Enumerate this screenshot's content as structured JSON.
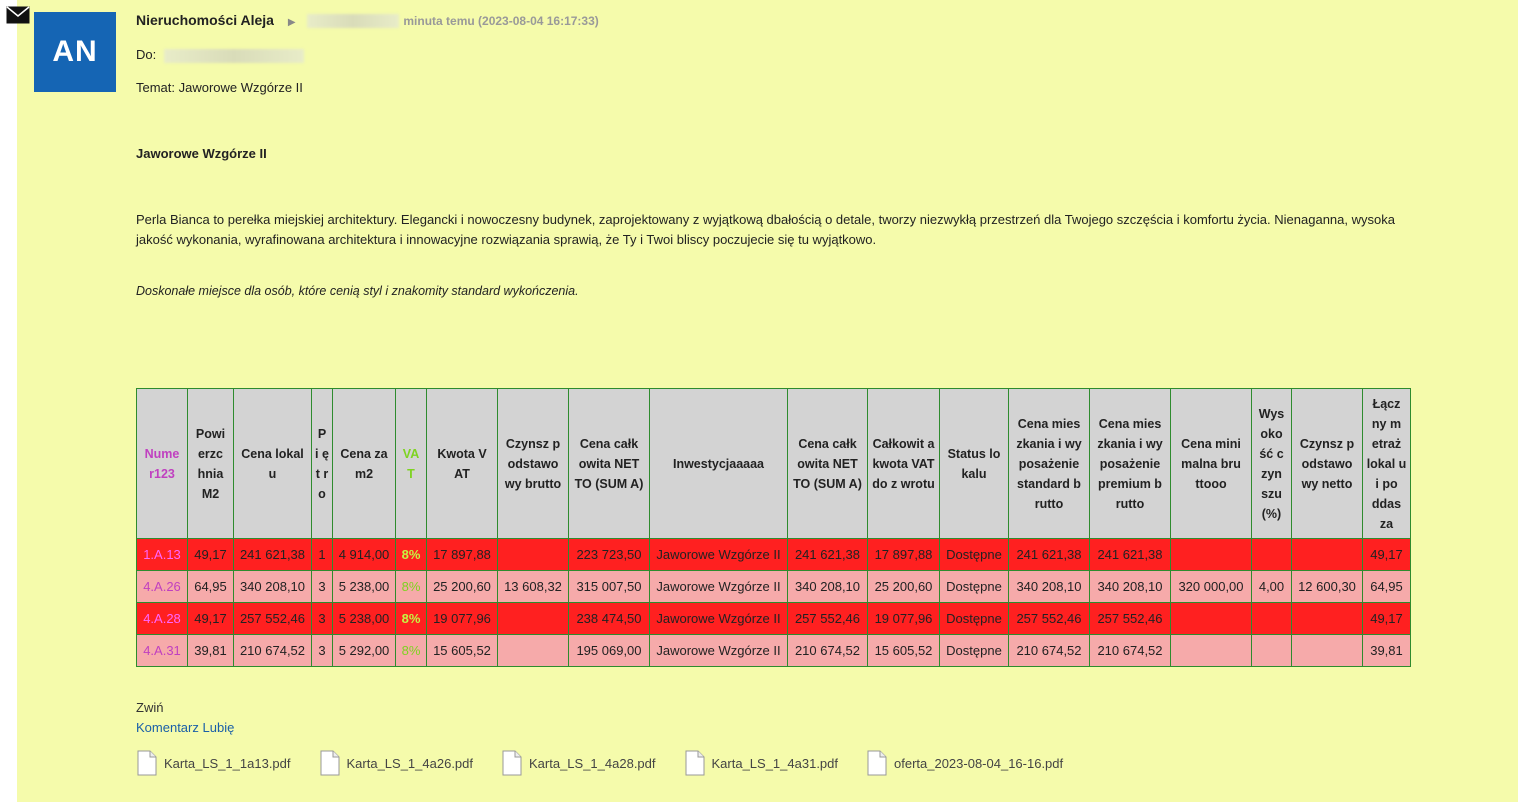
{
  "header": {
    "avatar_initials": "AN",
    "sender_name": "Nieruchomości Aleja",
    "time": "minuta temu (2023-08-04 16:17:33)",
    "to_label": "Do:",
    "subject": "Temat: Jaworowe Wzgórze II"
  },
  "message": {
    "title": "Jaworowe Wzgórze II",
    "paragraph": "Perla Bianca to perełka miejskiej architektury. Elegancki i nowoczesny budynek, zaprojektowany z wyjątkową dbałością o detale, tworzy niezwykłą przestrzeń dla Twojego szczęścia i komfortu życia. Nienaganna, wysoka jakość wykonania, wyrafinowana architektura i innowacyjne rozwiązania sprawią, że Ty i Twoi bliscy poczujecie się tu wyjątkowo.",
    "tagline": "Doskonałe miejsce dla osób, które cenią styl i znakomity standard wykończenia."
  },
  "table": {
    "headers": [
      "Nume r123",
      "Powi erzc hnia M2",
      "Cena lokal u",
      "P i ę t r o",
      "Cena za m2",
      "VA T",
      "Kwota V AT",
      "Czynsz p odstawo wy brutto",
      "Cena całk owita NET TO (SUM A)",
      "Inwestycjaaaaa",
      "Cena całk owita NET TO (SUM A)",
      "Całkowit a kwota VAT do z wrotu",
      "Status lo kalu",
      "Cena mies zkania i wy posażenie standard b rutto",
      "Cena mies zkania i wy posażenie premium b rutto",
      "Cena mini malna bru ttooo",
      "Wys oko ść c zyn szu (%)",
      "Czynsz p odstawo wy netto",
      "Łącz ny m etraż lokal u i po ddas za"
    ],
    "rows": [
      [
        "1.A.13",
        "49,17",
        "241 621,38",
        "1",
        "4 914,00",
        "8%",
        "17 897,88",
        "",
        "223 723,50",
        "Jaworowe Wzgórze II",
        "241 621,38",
        "17 897,88",
        "Dostępne",
        "241 621,38",
        "241 621,38",
        "",
        "",
        "",
        "49,17"
      ],
      [
        "4.A.26",
        "64,95",
        "340 208,10",
        "3",
        "5 238,00",
        "8%",
        "25 200,60",
        "13 608,32",
        "315 007,50",
        "Jaworowe Wzgórze II",
        "340 208,10",
        "25 200,60",
        "Dostępne",
        "340 208,10",
        "340 208,10",
        "320 000,00",
        "4,00",
        "12 600,30",
        "64,95"
      ],
      [
        "4.A.28",
        "49,17",
        "257 552,46",
        "3",
        "5 238,00",
        "8%",
        "19 077,96",
        "",
        "238 474,50",
        "Jaworowe Wzgórze II",
        "257 552,46",
        "19 077,96",
        "Dostępne",
        "257 552,46",
        "257 552,46",
        "",
        "",
        "",
        "49,17"
      ],
      [
        "4.A.31",
        "39,81",
        "210 674,52",
        "3",
        "5 292,00",
        "8%",
        "15 605,52",
        "",
        "195 069,00",
        "Jaworowe Wzgórze II",
        "210 674,52",
        "15 605,52",
        "Dostępne",
        "210 674,52",
        "210 674,52",
        "",
        "",
        "",
        "39,81"
      ]
    ],
    "row_styles": [
      "red",
      "pink",
      "red",
      "pink"
    ]
  },
  "footer": {
    "collapse": "Zwiń",
    "comment": "Komentarz",
    "like": "Lubię",
    "attachments": [
      "Karta_LS_1_1a13.pdf",
      "Karta_LS_1_4a26.pdf",
      "Karta_LS_1_4a28.pdf",
      "Karta_LS_1_4a31.pdf",
      "oferta_2023-08-04_16-16.pdf"
    ]
  },
  "colors": {
    "background": "#f5fbab",
    "avatar": "#1565b4",
    "row_red": "#ff2020",
    "row_pink": "#f6aaaa",
    "header_gray": "#d3d3d3",
    "link": "#1a5fa8"
  }
}
